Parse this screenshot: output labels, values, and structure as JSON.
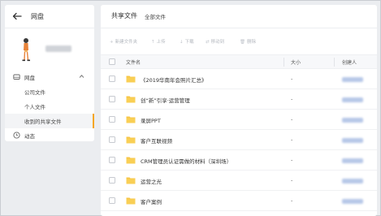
{
  "sidebar": {
    "title": "网盘",
    "nav": {
      "disk_label": "网盘",
      "company_files": "公司文件",
      "personal_files": "个人文件",
      "received_shared": "收到的共享文件",
      "activity": "动态"
    }
  },
  "main": {
    "tab_title": "共享文件",
    "tab_all": "全部文件",
    "toolbar": {
      "new_folder": "新建文件夹",
      "upload": "上传",
      "download": "下载",
      "move": "移动到",
      "delete": "删除"
    },
    "columns": {
      "name": "文件名",
      "size": "大小",
      "creator": "创建人"
    },
    "rows": [
      {
        "name": "《2019华南年会照片汇总》",
        "size": "-"
      },
      {
        "name": "创“新”引享·运营管理",
        "size": "-"
      },
      {
        "name": "录屏PPT",
        "size": "-"
      },
      {
        "name": "客户互联视频",
        "size": "-"
      },
      {
        "name": "CRM管理员认证需做的材料（深圳场）",
        "size": "-"
      },
      {
        "name": "运营之光",
        "size": "-"
      },
      {
        "name": "客户案例",
        "size": "-"
      }
    ]
  },
  "colors": {
    "accent": "#f5a623",
    "folder": "#f7c545",
    "border": "#c9ccd1"
  }
}
